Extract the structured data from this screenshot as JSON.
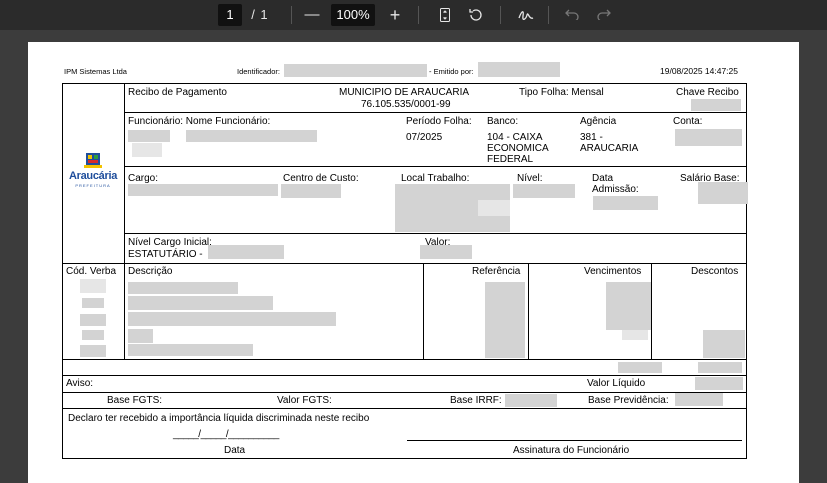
{
  "toolbar": {
    "page_current": "1",
    "page_sep": "/",
    "page_total": "1",
    "zoom_minus": "—",
    "zoom": "100%",
    "zoom_plus": "+"
  },
  "doc": {
    "company": "IPM Sistemas Ltda",
    "identificador_label": "Identificador:",
    "emitido_label": "- Emitido por:",
    "timestamp": "19/08/2025 14:47:25",
    "logo_text": "Araucária",
    "logo_sub": "PREFEITURA",
    "recibo_label": "Recibo de Pagamento",
    "municipio": "MUNICIPIO DE ARAUCARIA",
    "cnpj": "76.105.535/0001-99",
    "tipo_folha": "Tipo Folha: Mensal",
    "chave_recibo": "Chave Recibo",
    "funcionario_label": "Funcionário: Nome Funcionário:",
    "periodo_label": "Período Folha:",
    "periodo_value": "07/2025",
    "banco_label": "Banco:",
    "banco_value_1": "104 - CAIXA",
    "banco_value_2": "ECONOMICA",
    "banco_value_3": "FEDERAL",
    "agencia_label": "Agência",
    "agencia_value_1": "381 -",
    "agencia_value_2": "ARAUCARIA",
    "conta_label": "Conta:",
    "cargo_label": "Cargo:",
    "centro_label": "Centro de Custo:",
    "local_label": "Local Trabalho:",
    "nivel_label": "Nível:",
    "data_label_1": "Data",
    "data_label_2": "Admissão:",
    "salario_label": "Salário Base:",
    "nivel_inicial_label": "Nível Cargo Inicial:",
    "nivel_inicial_value": "ESTATUTÁRIO -",
    "valor_label": "Valor:",
    "col_cod": "Cód. Verba",
    "col_desc": "Descrição",
    "col_ref": "Referência",
    "col_venc": "Vencimentos",
    "col_desc2": "Descontos",
    "aviso": "Aviso:",
    "valor_liquido": "Valor Líquido",
    "base_fgts": "Base FGTS:",
    "valor_fgts": "Valor FGTS:",
    "base_irrf": "Base IRRF:",
    "base_prev": "Base Previdência:",
    "declaro": "Declaro ter recebido a importância líquida discriminada neste recibo",
    "date_blank": "_____/_____/__________",
    "data_caption": "Data",
    "assinatura_caption": "Assinatura do Funcionário"
  }
}
